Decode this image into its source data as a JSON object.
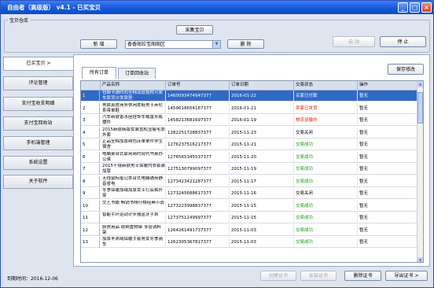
{
  "window": {
    "title": "自由者（高级版）  v4.1 - 已买宝贝"
  },
  "group": {
    "legend": "宝贝仓库",
    "collect_button": "采集宝贝",
    "new_button": "新 增",
    "combo_value": "香香阁珍宝阁阁区",
    "delete_button": "删 除",
    "start_button": "启 动",
    "stop_button": "停 止"
  },
  "sidebar": {
    "items": [
      {
        "label": "已买宝贝 >"
      },
      {
        "label": "评论管理"
      },
      {
        "label": "支付宝收支明细"
      },
      {
        "label": "支付宝回收站"
      },
      {
        "label": "手机端管理"
      },
      {
        "label": "系统设置"
      },
      {
        "label": "关于软件"
      }
    ]
  },
  "tabs": [
    {
      "label": "所有订单"
    },
    {
      "label": "订单回收站"
    }
  ],
  "save_button": "保存修改",
  "table": {
    "columns": [
      "产品名称",
      "订单号",
      "订单日期",
      "交易状态",
      "操作"
    ],
    "rows": [
      {
        "num": "1",
        "name": "包邮卡通时尚全棉双层抱枕可爱车靠背沙发靠垫",
        "order": "1460093474947377",
        "date": "2016-01-22",
        "status": "买家已付款",
        "status_color": "#ffffff",
        "op": "暂无",
        "selected": true
      },
      {
        "num": "2",
        "name": "男款真皮商务休闲皮鞋男士英伦系带单鞋",
        "order": "1459618654167377",
        "date": "2016-01-21",
        "status": "卖家已发货",
        "status_color": "#d81e06",
        "op": "暂无"
      },
      {
        "num": "3",
        "name": "汽车新款香水座挂饰车载香水瓶摆件",
        "order": "1458213681697377",
        "date": "2016-01-19",
        "status": "物流运输中",
        "status_color": "#d81e06",
        "op": "暂无"
      },
      {
        "num": "4",
        "name": "2015新款韩版女装宽松显瘦毛衣外套",
        "order": "1282251728837377",
        "date": "2015-11-23",
        "status": "交易关闭",
        "status_color": "#000000",
        "op": "暂无"
      },
      {
        "num": "5",
        "name": "正品全棉加厚纯色床单单件学生宿舍",
        "order": "1276237516217377",
        "date": "2015-11-21",
        "status": "交易成功",
        "status_color": "#1a9b1a",
        "op": "暂无"
      },
      {
        "num": "6",
        "name": "电脑桌台式家用简约现代书桌办公桌",
        "order": "1276565345537377",
        "date": "2015-11-20",
        "status": "交易成功",
        "status_color": "#1a9b1a",
        "op": "暂无"
      },
      {
        "num": "7",
        "name": "2015千禧新款男士保暖内衣套装加厚",
        "order": "1275130799097377",
        "date": "2015-11-19",
        "status": "交易成功",
        "status_color": "#1a9b1a",
        "op": "暂无"
      },
      {
        "num": "8",
        "name": "无线鼠标笔记本台式电脑通用静音省电",
        "order": "1273423421287377",
        "date": "2015-11-17",
        "status": "交易成功",
        "status_color": "#1a9b1a",
        "op": "暂无"
      },
      {
        "num": "9",
        "name": "冬季保暖加绒加厚女士打底裤外穿",
        "order": "1273245688617377",
        "date": "2015-11-16",
        "status": "交易关闭",
        "status_color": "#000000",
        "op": "暂无"
      },
      {
        "num": "10",
        "name": "文艺书籍 畅销书排行榜经典小说",
        "order": "1273223998837377",
        "date": "2015-11-15",
        "status": "交易成功",
        "status_color": "#1a9b1a",
        "op": "暂无"
      },
      {
        "num": "11",
        "name": "智能手环运动计步器蓝牙手表",
        "order": "1273751249997377",
        "date": "2015-11-15",
        "status": "交易成功",
        "status_color": "#1a9b1a",
        "op": "暂无"
      },
      {
        "num": "12",
        "name": "厨房用品 收纳置物架 多层调料架",
        "order": "1264261491737377",
        "date": "2015-11-03",
        "status": "交易成功",
        "status_color": "#1a9b1a",
        "op": "暂无"
      },
      {
        "num": "13",
        "name": "加厚羊羔绒保暖手套男女冬季骑车",
        "order": "1262305367817377",
        "date": "2015-11-03",
        "status": "交易成功",
        "status_color": "#1a9b1a",
        "op": "暂无"
      }
    ]
  },
  "footer": {
    "expiry": "到期时间：2016-12-06",
    "create_cert": "创建证书",
    "install_cert": "安装证书",
    "delete_cert": "删除证书",
    "export_cert": "导出证书 >"
  }
}
